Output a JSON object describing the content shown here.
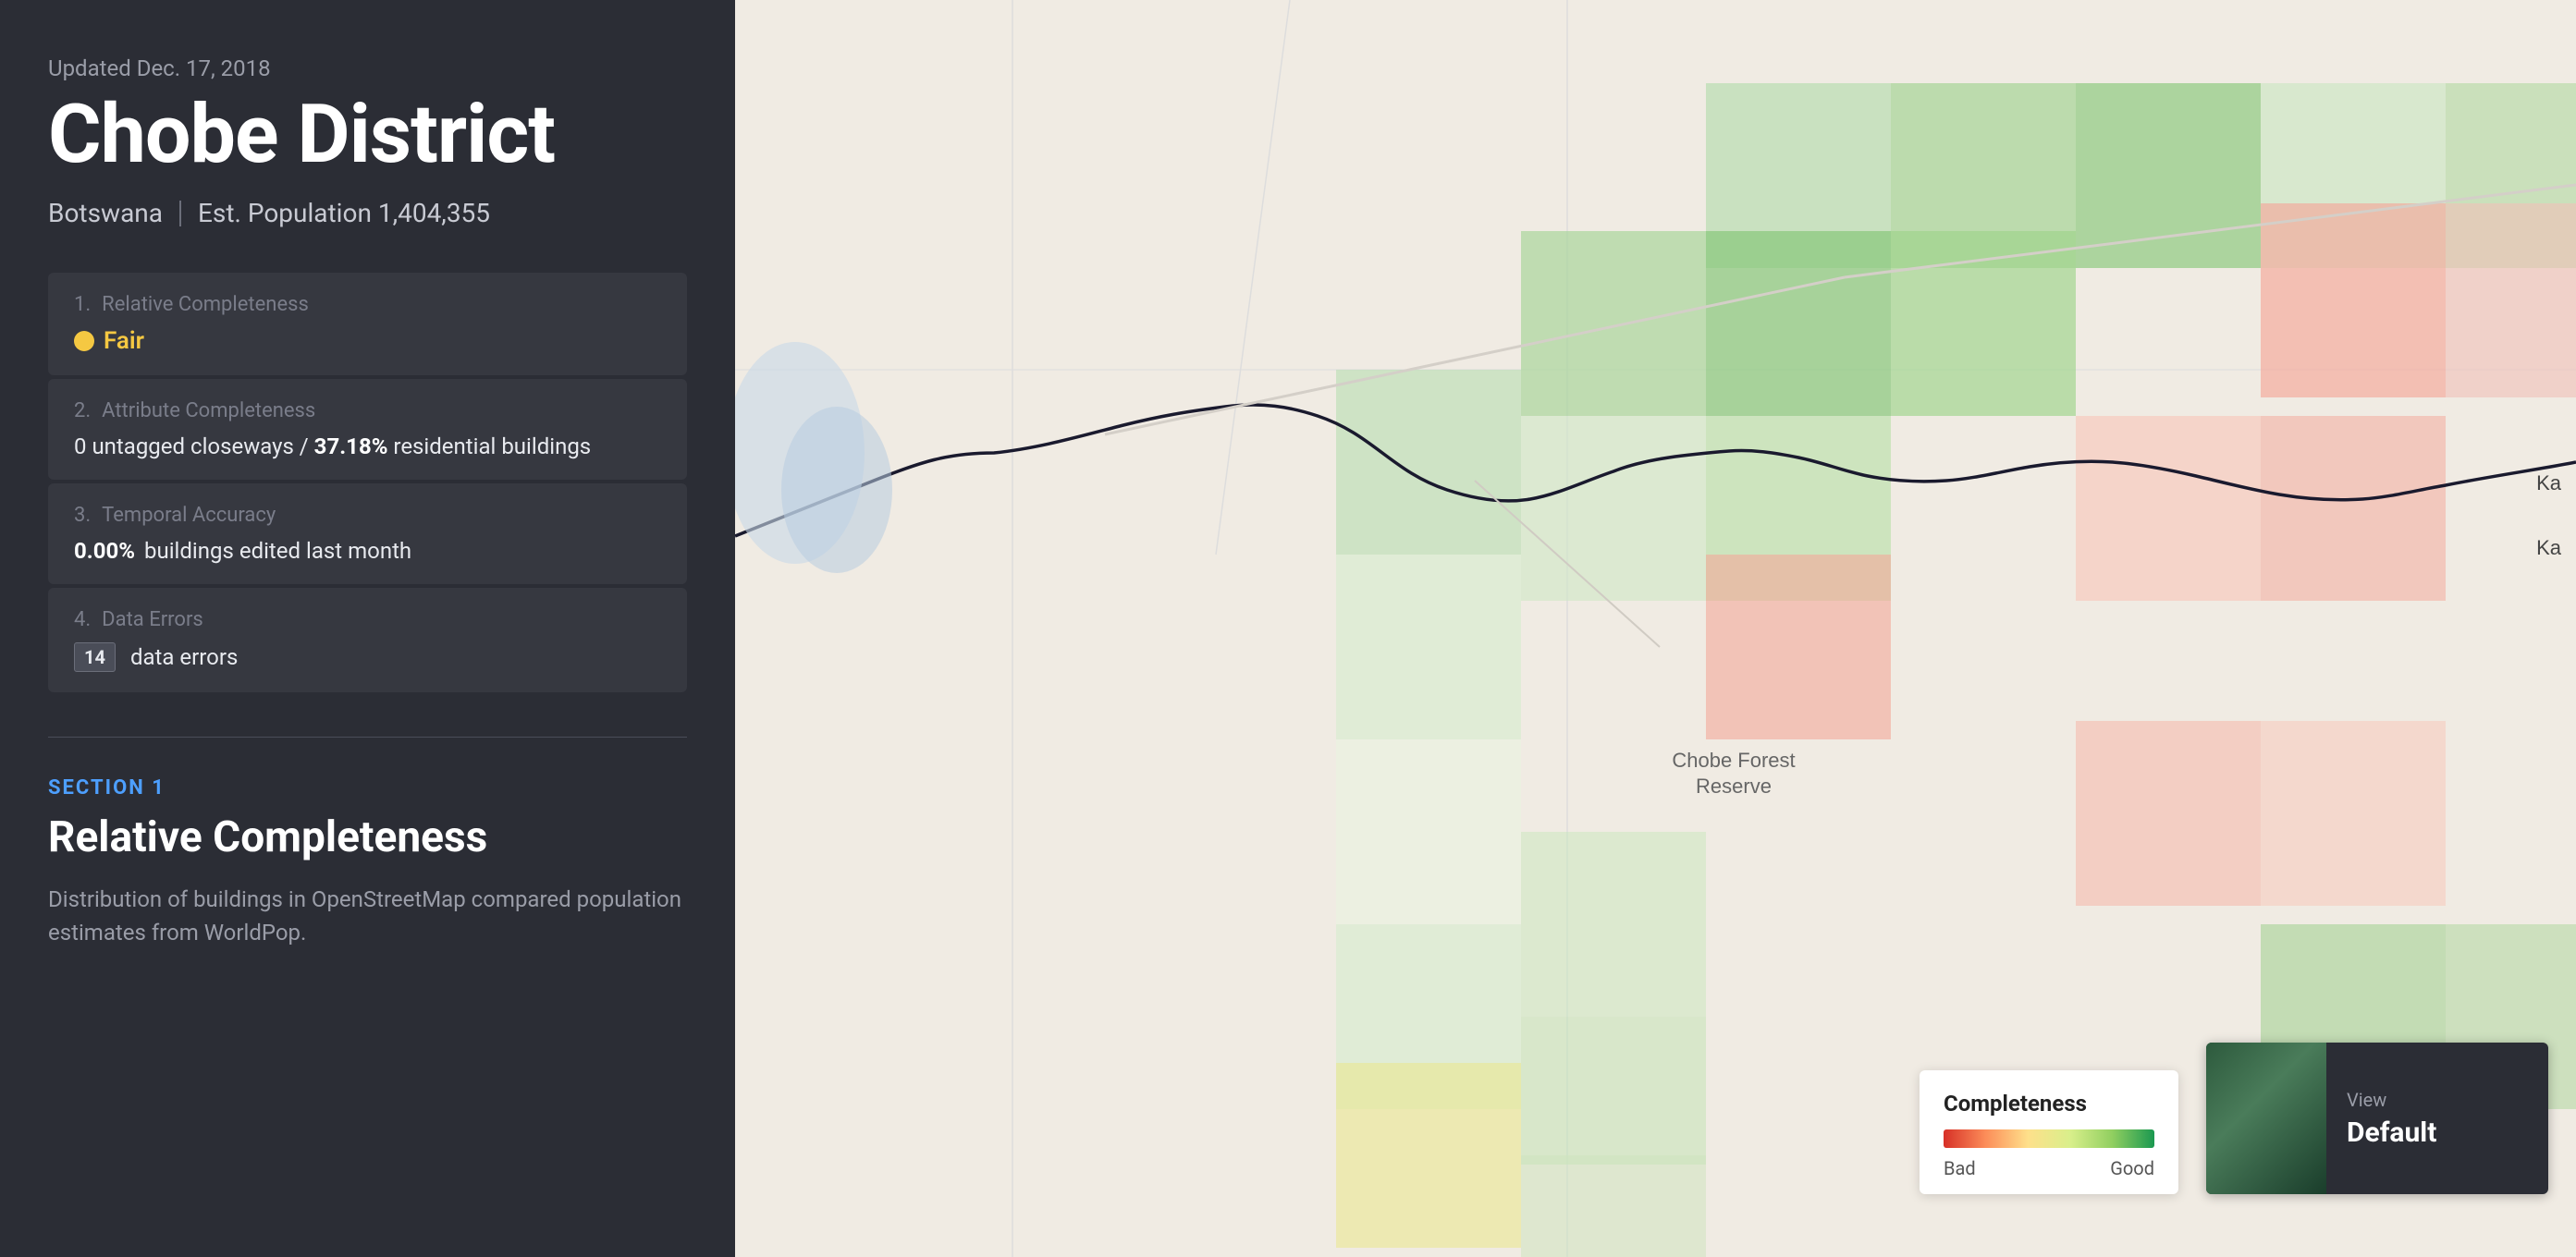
{
  "leftPanel": {
    "updated": "Updated Dec. 17, 2018",
    "title": "Chobe District",
    "country": "Botswana",
    "population_label": "Est. Population 1,404,355",
    "metrics": [
      {
        "number": "1.",
        "label": "Relative Completeness",
        "value_type": "badge",
        "badge_label": "Fair",
        "badge_color": "#f5c842"
      },
      {
        "number": "2.",
        "label": "Attribute Completeness",
        "value_type": "text",
        "value": "0 untagged closeways / 37.18% residential buildings",
        "bold_part": "37.18%",
        "prefix": "0 untagged closeways / ",
        "suffix": " residential buildings"
      },
      {
        "number": "3.",
        "label": "Temporal Accuracy",
        "value_type": "text",
        "value": "0.00% buildings edited last month",
        "bold_part": "0.00%",
        "suffix": " buildings edited last month"
      },
      {
        "number": "4.",
        "label": "Data Errors",
        "value_type": "errors",
        "error_count": "14",
        "error_label": "data errors"
      }
    ],
    "section_label": "SECTION 1",
    "section_title": "Relative Completeness",
    "section_desc": "Distribution of buildings in OpenStreetMap compared population estimates from WorldPop."
  },
  "legend": {
    "title": "Completeness",
    "bad_label": "Bad",
    "good_label": "Good"
  },
  "view": {
    "label": "View",
    "name": "Default"
  },
  "map": {
    "forest_label": "Chobe Forest\nReserve",
    "place_label": "Ka"
  }
}
